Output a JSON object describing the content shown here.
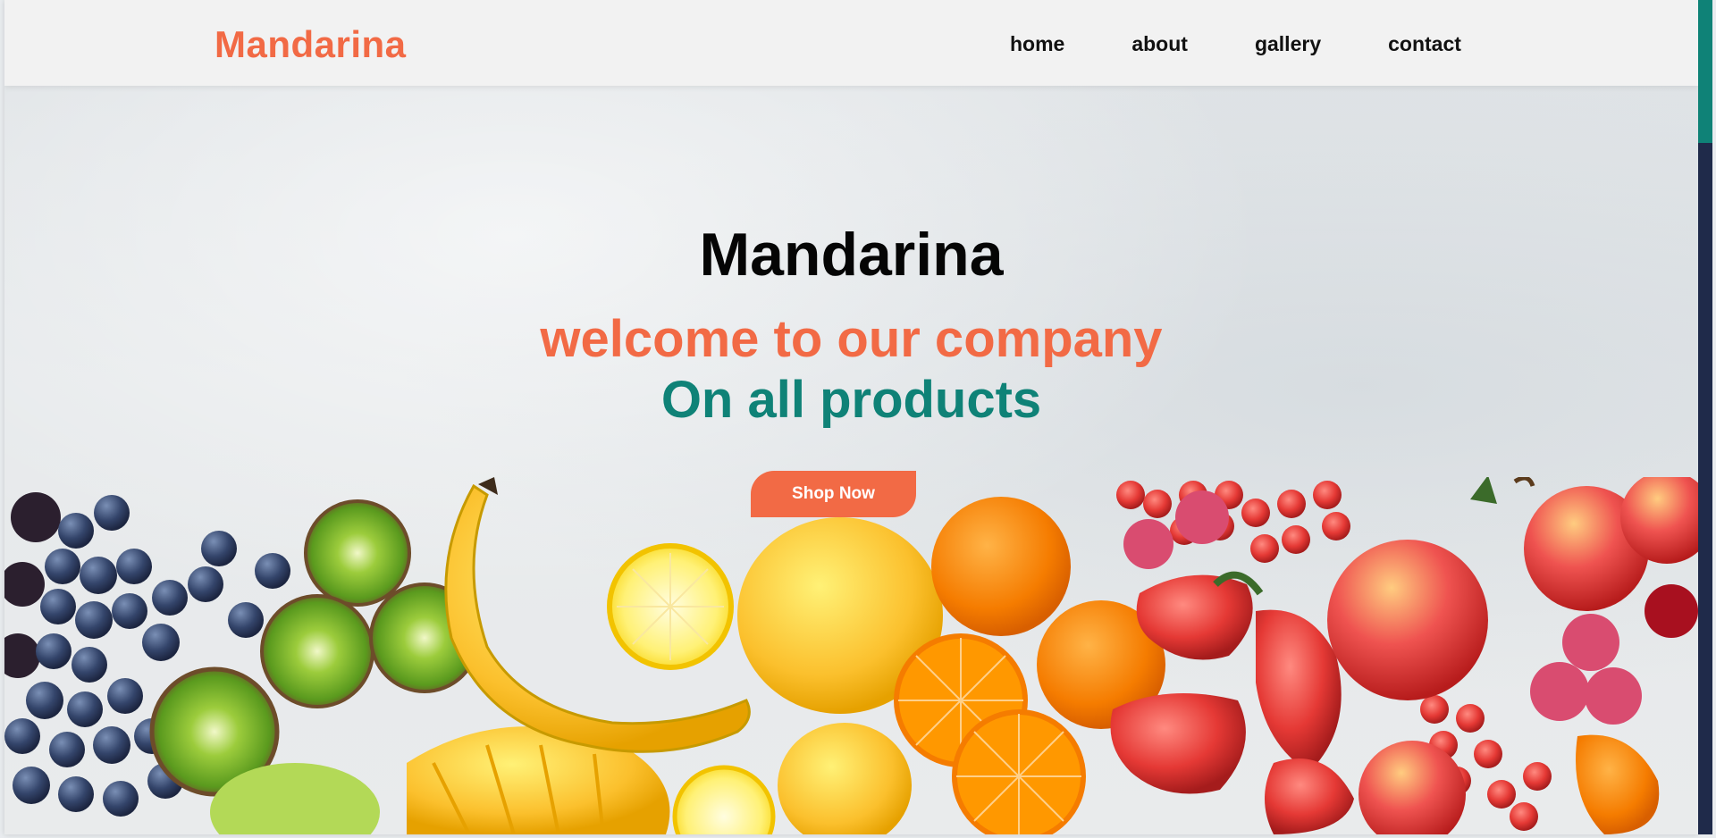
{
  "header": {
    "logo": "Mandarina",
    "nav": [
      "home",
      "about",
      "gallery",
      "contact"
    ]
  },
  "hero": {
    "title": "Mandarina",
    "subtitle_1": "welcome to our company",
    "subtitle_2": "On all products",
    "button_label": "Shop Now",
    "background_image": "fruit-assortment"
  },
  "colors": {
    "accent": "#f26a45",
    "secondary": "#0f8277",
    "scrollbar_track": "#1f2a4a",
    "scrollbar_thumb": "#0f8277"
  }
}
